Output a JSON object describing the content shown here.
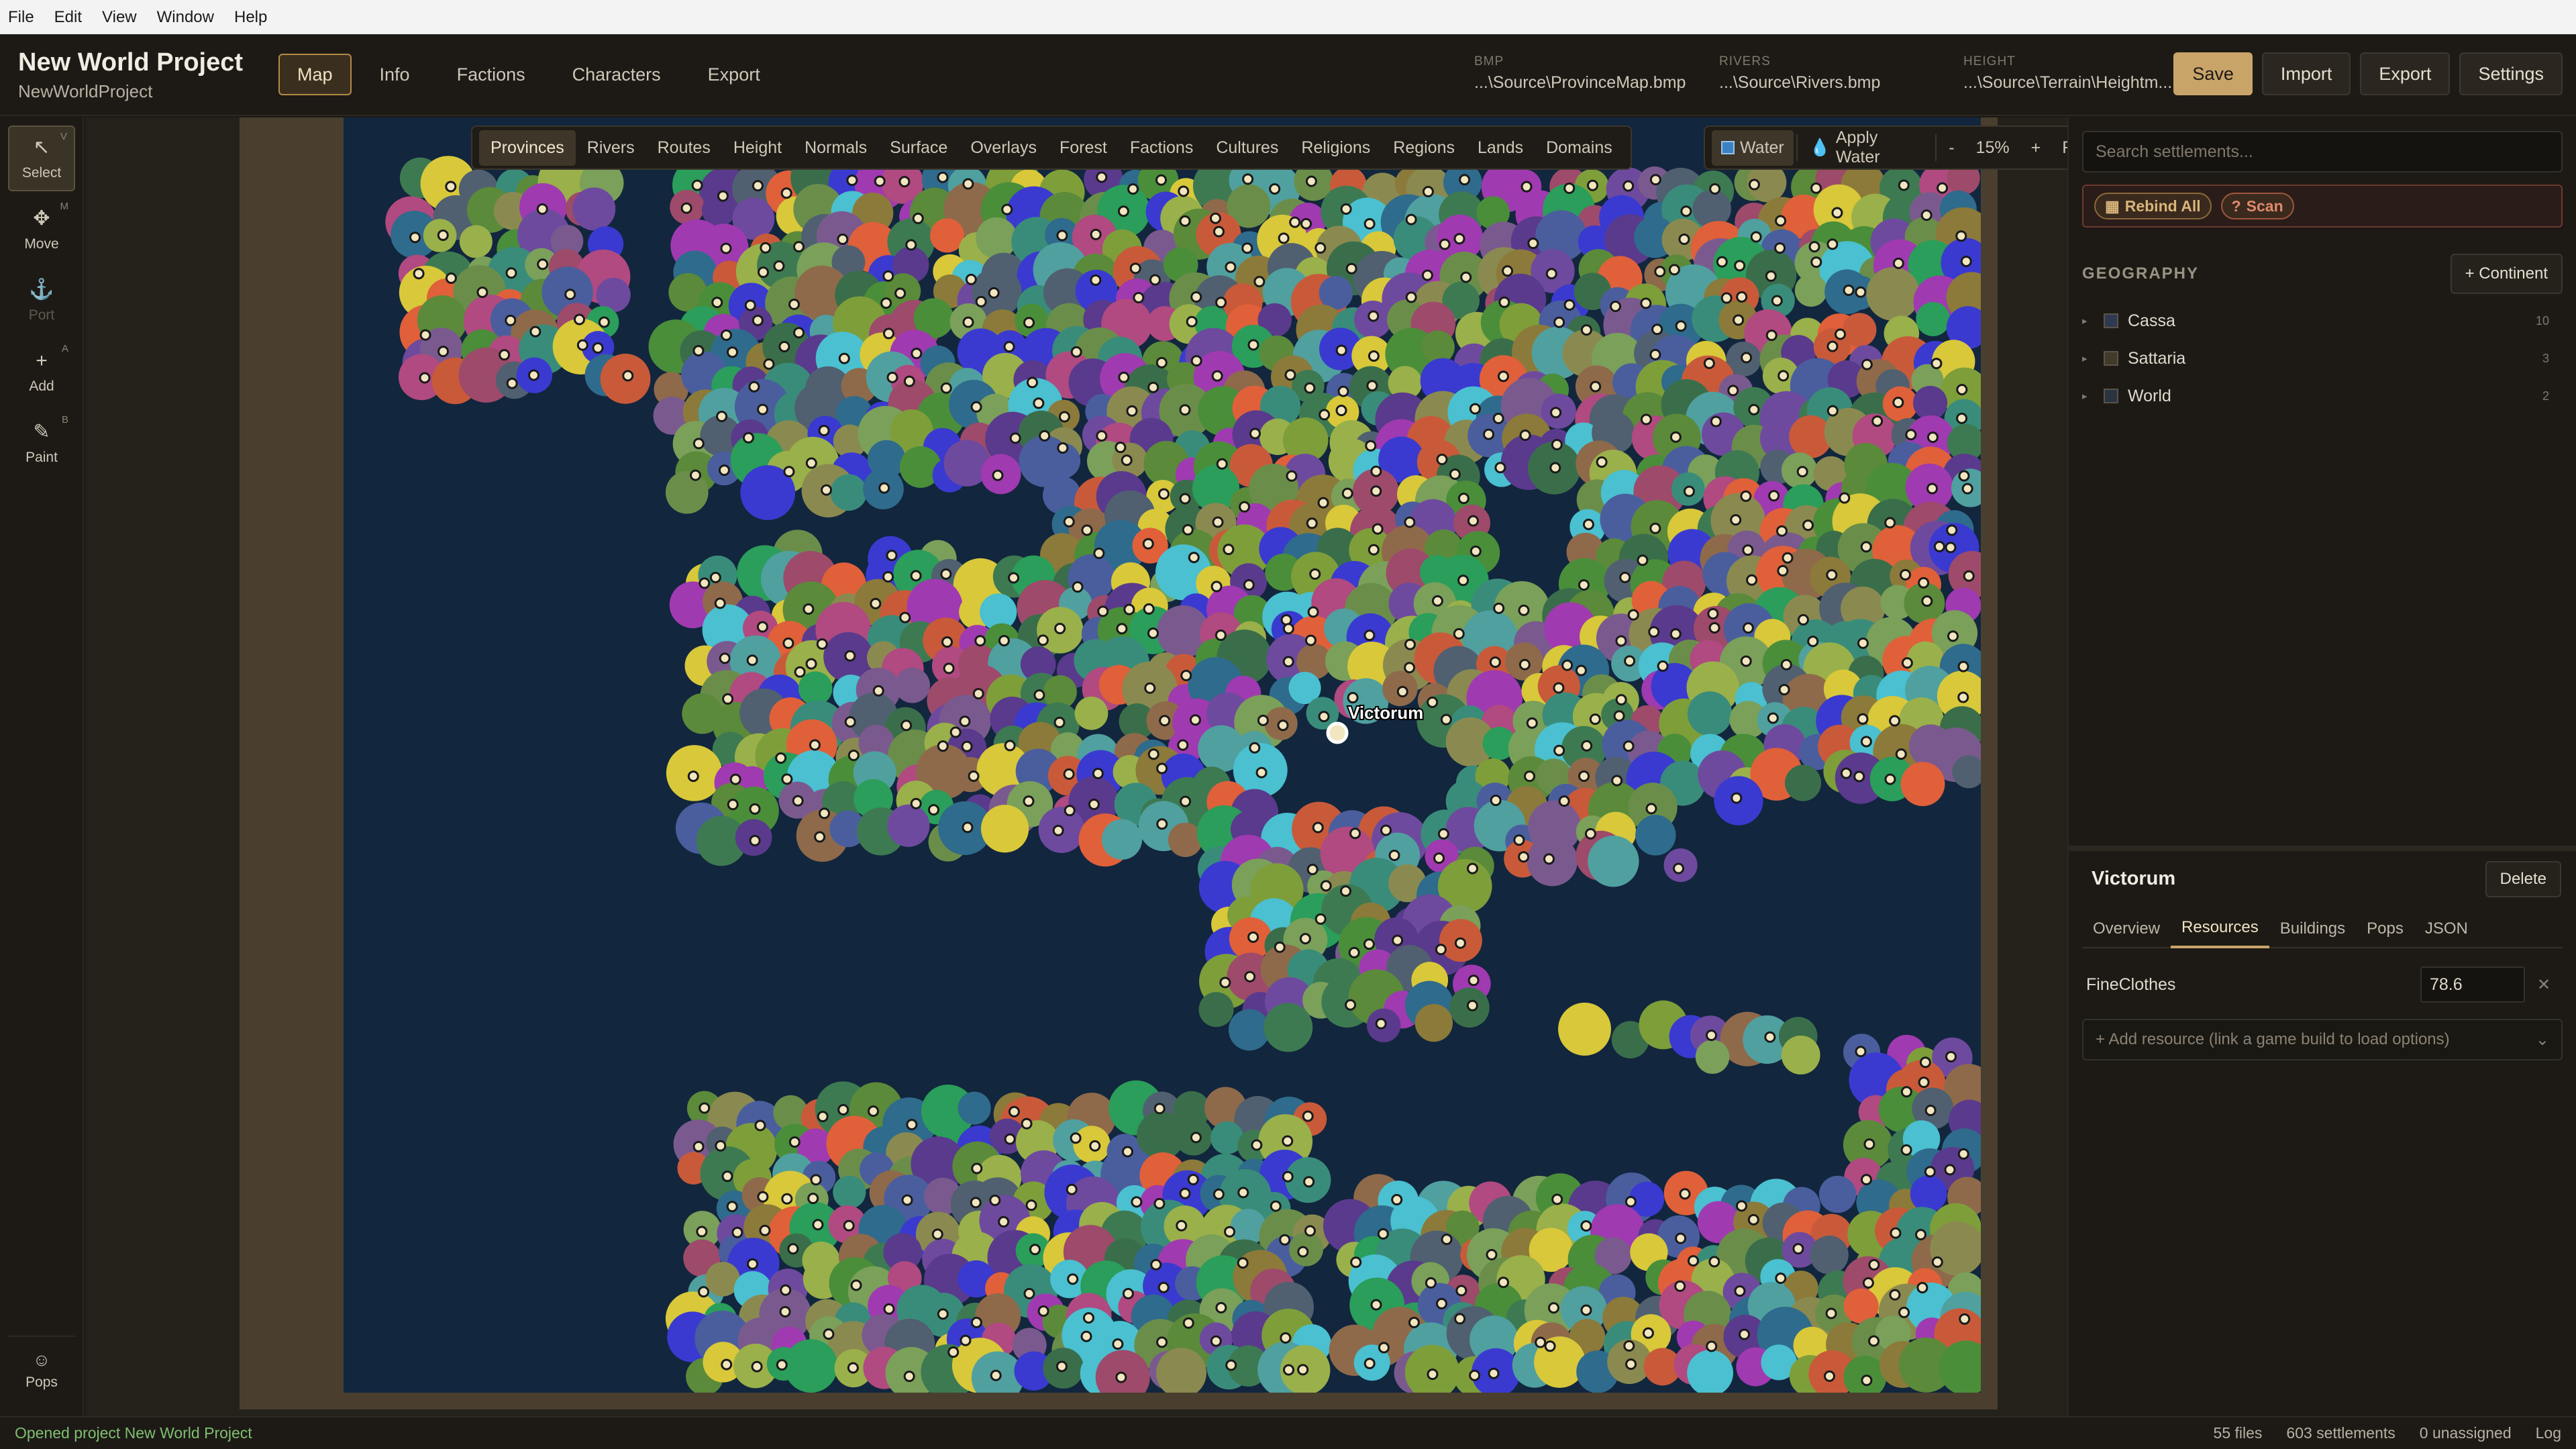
{
  "menubar": {
    "items": [
      "File",
      "Edit",
      "View",
      "Window",
      "Help"
    ]
  },
  "header": {
    "title": "New World Project",
    "subtitle": "NewWorldProject",
    "nav": [
      "Map",
      "Info",
      "Factions",
      "Characters",
      "Export"
    ],
    "active_nav": "Map",
    "sources": [
      {
        "label": "BMP",
        "value": "...\\Source\\ProvinceMap.bmp"
      },
      {
        "label": "RIVERS",
        "value": "...\\Source\\Rivers.bmp"
      },
      {
        "label": "HEIGHT",
        "value": "...\\Source\\Terrain\\Heightm..."
      }
    ],
    "buttons": {
      "save": "Save",
      "import": "Import",
      "export": "Export",
      "settings": "Settings"
    }
  },
  "tools": [
    {
      "label": "Select",
      "key": "V",
      "icon": "arrow-pointer-icon"
    },
    {
      "label": "Move",
      "key": "M",
      "icon": "move-icon"
    },
    {
      "label": "Port",
      "key": "",
      "icon": "anchor-icon"
    },
    {
      "label": "Add",
      "key": "A",
      "icon": "plus-icon"
    },
    {
      "label": "Paint",
      "key": "B",
      "icon": "pencil-icon"
    }
  ],
  "pops_tool": "Pops",
  "map": {
    "layers": [
      "Provinces",
      "Rivers",
      "Routes",
      "Height",
      "Normals",
      "Surface",
      "Overlays",
      "Forest",
      "Factions",
      "Cultures",
      "Religions",
      "Regions",
      "Lands",
      "Domains"
    ],
    "active_layer": "Provinces",
    "water": "Water",
    "apply_water": "Apply Water",
    "zoom_out": "-",
    "zoom": "15%",
    "zoom_in": "+",
    "fit": "Fit",
    "selected_label": "Victorum",
    "colors": {
      "ocean": "#12263e",
      "frame": "#4a3f2e",
      "accent": "#c9a469"
    }
  },
  "panel": {
    "search_placeholder": "Search settlements...",
    "rebind_all": "Rebind All",
    "scan": "Scan",
    "geography_header": "GEOGRAPHY",
    "add_continent": "+ Continent",
    "continents": [
      {
        "name": "Cassa",
        "count": "10",
        "color": "#2f3a52"
      },
      {
        "name": "Sattaria",
        "count": "3",
        "color": "#3f3a2a"
      },
      {
        "name": "World",
        "count": "2",
        "color": "#2a3340"
      }
    ],
    "detail": {
      "title": "Victorum",
      "delete": "Delete",
      "tabs": [
        "Overview",
        "Resources",
        "Buildings",
        "Pops",
        "JSON"
      ],
      "active_tab": "Resources",
      "resource_name": "FineClothes",
      "resource_value": "78.6",
      "add_resource": "+ Add resource (link a game build to load options)"
    }
  },
  "status": {
    "message": "Opened project New World Project",
    "files": "55 files",
    "settlements": "603 settlements",
    "unassigned": "0 unassigned",
    "log": "Log"
  }
}
